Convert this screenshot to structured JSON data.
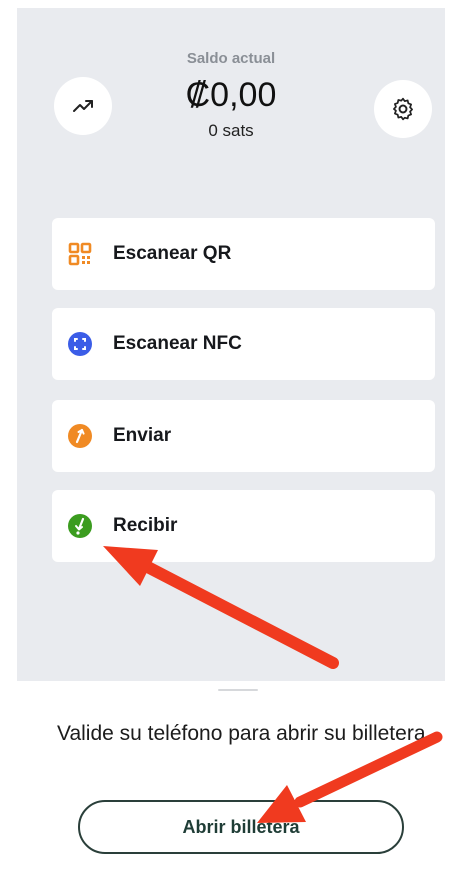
{
  "balance": {
    "label": "Saldo actual",
    "amount": "₡0,00",
    "sats": "0 sats"
  },
  "header": {
    "left_icon": "trending-up-icon",
    "right_icon": "gear-icon"
  },
  "actions": [
    {
      "label": "Escanear QR",
      "icon": "qr-code-icon",
      "color": "#f08a24"
    },
    {
      "label": "Escanear NFC",
      "icon": "nfc-scan-icon",
      "color": "#3b5de7"
    },
    {
      "label": "Enviar",
      "icon": "send-icon",
      "color": "#f08a24"
    },
    {
      "label": "Recibir",
      "icon": "receive-icon",
      "color": "#3b9c1f"
    }
  ],
  "bottom_sheet": {
    "message": "Valide su teléfono para abrir su billetera",
    "button_label": "Abrir billetera"
  },
  "colors": {
    "background": "#e9ebef",
    "annotation_arrow": "#f03a1f"
  }
}
